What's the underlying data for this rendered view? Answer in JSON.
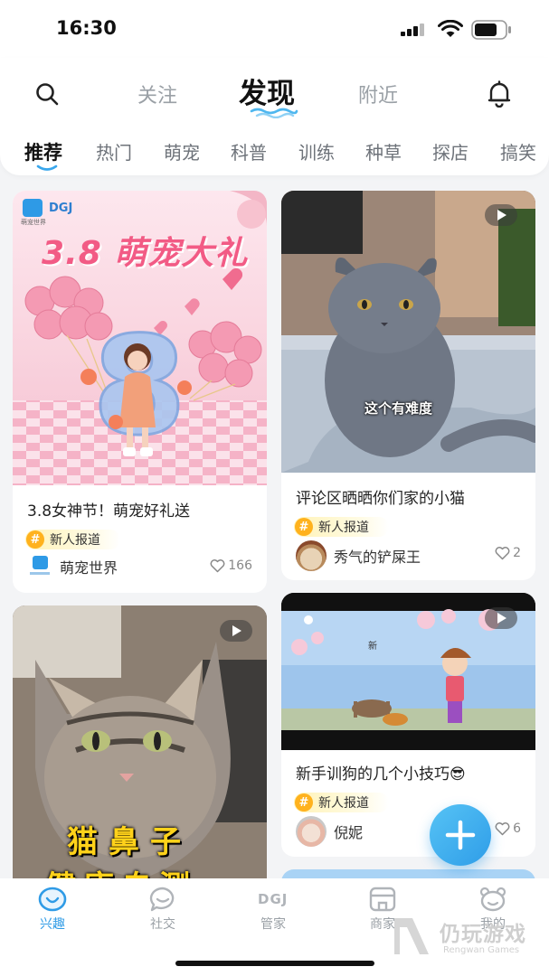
{
  "status_bar": {
    "time": "16:30"
  },
  "header": {
    "tabs": [
      {
        "label": "关注",
        "active": false
      },
      {
        "label": "发现",
        "active": true
      },
      {
        "label": "附近",
        "active": false
      }
    ],
    "search_icon": "search-icon",
    "bell_icon": "bell-icon"
  },
  "categories": [
    {
      "label": "推荐",
      "active": true
    },
    {
      "label": "热门",
      "active": false
    },
    {
      "label": "萌宠",
      "active": false
    },
    {
      "label": "科普",
      "active": false
    },
    {
      "label": "训练",
      "active": false
    },
    {
      "label": "种草",
      "active": false
    },
    {
      "label": "探店",
      "active": false
    },
    {
      "label": "搞笑",
      "active": false
    }
  ],
  "feed": [
    {
      "title": "3.8女神节！萌宠好礼送",
      "tag": "新人报道",
      "author": "萌宠世界",
      "likes": "166",
      "cover": {
        "brand_logo": "DGJ",
        "heading": "3.8 萌宠大礼",
        "logo_caption": "萌宠世界"
      }
    },
    {
      "title": "评论区晒晒你们家的小猫",
      "tag": "新人报道",
      "author": "秀气的铲屎王",
      "likes": "2",
      "cover": {
        "caption": "这个有难度",
        "is_video": true
      }
    },
    {
      "title": "",
      "tag": "",
      "author": "",
      "likes": "",
      "cover": {
        "caption": "猫鼻子",
        "caption2": "健康自测",
        "is_video": true
      }
    },
    {
      "title": "新手训狗的几个小技巧😎",
      "tag": "新人报道",
      "author": "倪妮",
      "likes": "6",
      "cover": {
        "is_video": true,
        "small_text": "新"
      }
    }
  ],
  "tag_symbol": "#",
  "bottom_nav": [
    {
      "label": "兴趣",
      "active": true,
      "icon": "interest-icon"
    },
    {
      "label": "社交",
      "active": false,
      "icon": "chat-icon"
    },
    {
      "label": "管家",
      "active": false,
      "icon": "dgj-icon",
      "icon_text": "DGJ"
    },
    {
      "label": "商家",
      "active": false,
      "icon": "shop-icon"
    },
    {
      "label": "我的",
      "active": false,
      "icon": "profile-icon"
    }
  ],
  "fab": {
    "icon": "plus-icon"
  },
  "watermark": {
    "text": "仍玩游戏",
    "sub": "Rengwan Games"
  },
  "colors": {
    "accent": "#2f9be6",
    "tag_yellow": "#ffb21e"
  }
}
